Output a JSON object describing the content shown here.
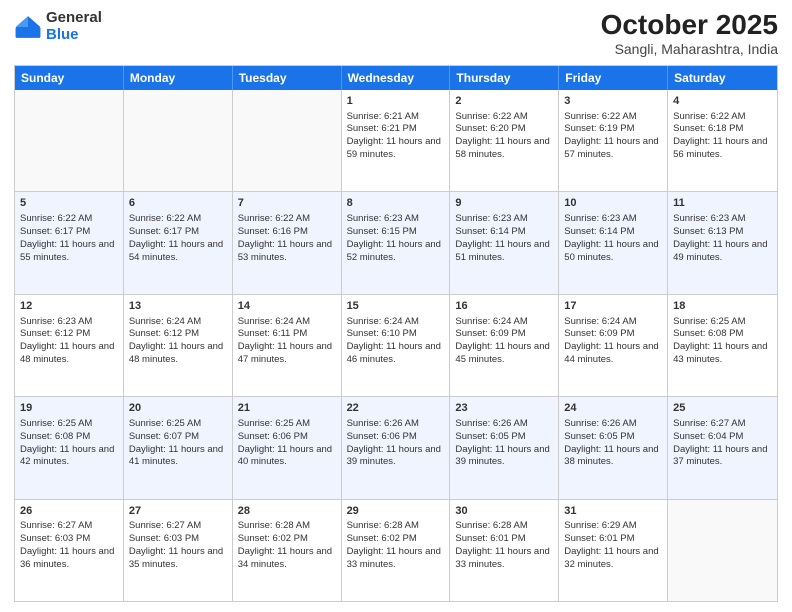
{
  "header": {
    "logo": {
      "general": "General",
      "blue": "Blue"
    },
    "title": "October 2025",
    "subtitle": "Sangli, Maharashtra, India"
  },
  "days": [
    "Sunday",
    "Monday",
    "Tuesday",
    "Wednesday",
    "Thursday",
    "Friday",
    "Saturday"
  ],
  "rows": [
    [
      {
        "day": "",
        "content": ""
      },
      {
        "day": "",
        "content": ""
      },
      {
        "day": "",
        "content": ""
      },
      {
        "day": "1",
        "content": "Sunrise: 6:21 AM\nSunset: 6:21 PM\nDaylight: 11 hours and 59 minutes."
      },
      {
        "day": "2",
        "content": "Sunrise: 6:22 AM\nSunset: 6:20 PM\nDaylight: 11 hours and 58 minutes."
      },
      {
        "day": "3",
        "content": "Sunrise: 6:22 AM\nSunset: 6:19 PM\nDaylight: 11 hours and 57 minutes."
      },
      {
        "day": "4",
        "content": "Sunrise: 6:22 AM\nSunset: 6:18 PM\nDaylight: 11 hours and 56 minutes."
      }
    ],
    [
      {
        "day": "5",
        "content": "Sunrise: 6:22 AM\nSunset: 6:17 PM\nDaylight: 11 hours and 55 minutes."
      },
      {
        "day": "6",
        "content": "Sunrise: 6:22 AM\nSunset: 6:17 PM\nDaylight: 11 hours and 54 minutes."
      },
      {
        "day": "7",
        "content": "Sunrise: 6:22 AM\nSunset: 6:16 PM\nDaylight: 11 hours and 53 minutes."
      },
      {
        "day": "8",
        "content": "Sunrise: 6:23 AM\nSunset: 6:15 PM\nDaylight: 11 hours and 52 minutes."
      },
      {
        "day": "9",
        "content": "Sunrise: 6:23 AM\nSunset: 6:14 PM\nDaylight: 11 hours and 51 minutes."
      },
      {
        "day": "10",
        "content": "Sunrise: 6:23 AM\nSunset: 6:14 PM\nDaylight: 11 hours and 50 minutes."
      },
      {
        "day": "11",
        "content": "Sunrise: 6:23 AM\nSunset: 6:13 PM\nDaylight: 11 hours and 49 minutes."
      }
    ],
    [
      {
        "day": "12",
        "content": "Sunrise: 6:23 AM\nSunset: 6:12 PM\nDaylight: 11 hours and 48 minutes."
      },
      {
        "day": "13",
        "content": "Sunrise: 6:24 AM\nSunset: 6:12 PM\nDaylight: 11 hours and 48 minutes."
      },
      {
        "day": "14",
        "content": "Sunrise: 6:24 AM\nSunset: 6:11 PM\nDaylight: 11 hours and 47 minutes."
      },
      {
        "day": "15",
        "content": "Sunrise: 6:24 AM\nSunset: 6:10 PM\nDaylight: 11 hours and 46 minutes."
      },
      {
        "day": "16",
        "content": "Sunrise: 6:24 AM\nSunset: 6:09 PM\nDaylight: 11 hours and 45 minutes."
      },
      {
        "day": "17",
        "content": "Sunrise: 6:24 AM\nSunset: 6:09 PM\nDaylight: 11 hours and 44 minutes."
      },
      {
        "day": "18",
        "content": "Sunrise: 6:25 AM\nSunset: 6:08 PM\nDaylight: 11 hours and 43 minutes."
      }
    ],
    [
      {
        "day": "19",
        "content": "Sunrise: 6:25 AM\nSunset: 6:08 PM\nDaylight: 11 hours and 42 minutes."
      },
      {
        "day": "20",
        "content": "Sunrise: 6:25 AM\nSunset: 6:07 PM\nDaylight: 11 hours and 41 minutes."
      },
      {
        "day": "21",
        "content": "Sunrise: 6:25 AM\nSunset: 6:06 PM\nDaylight: 11 hours and 40 minutes."
      },
      {
        "day": "22",
        "content": "Sunrise: 6:26 AM\nSunset: 6:06 PM\nDaylight: 11 hours and 39 minutes."
      },
      {
        "day": "23",
        "content": "Sunrise: 6:26 AM\nSunset: 6:05 PM\nDaylight: 11 hours and 39 minutes."
      },
      {
        "day": "24",
        "content": "Sunrise: 6:26 AM\nSunset: 6:05 PM\nDaylight: 11 hours and 38 minutes."
      },
      {
        "day": "25",
        "content": "Sunrise: 6:27 AM\nSunset: 6:04 PM\nDaylight: 11 hours and 37 minutes."
      }
    ],
    [
      {
        "day": "26",
        "content": "Sunrise: 6:27 AM\nSunset: 6:03 PM\nDaylight: 11 hours and 36 minutes."
      },
      {
        "day": "27",
        "content": "Sunrise: 6:27 AM\nSunset: 6:03 PM\nDaylight: 11 hours and 35 minutes."
      },
      {
        "day": "28",
        "content": "Sunrise: 6:28 AM\nSunset: 6:02 PM\nDaylight: 11 hours and 34 minutes."
      },
      {
        "day": "29",
        "content": "Sunrise: 6:28 AM\nSunset: 6:02 PM\nDaylight: 11 hours and 33 minutes."
      },
      {
        "day": "30",
        "content": "Sunrise: 6:28 AM\nSunset: 6:01 PM\nDaylight: 11 hours and 33 minutes."
      },
      {
        "day": "31",
        "content": "Sunrise: 6:29 AM\nSunset: 6:01 PM\nDaylight: 11 hours and 32 minutes."
      },
      {
        "day": "",
        "content": ""
      }
    ]
  ]
}
